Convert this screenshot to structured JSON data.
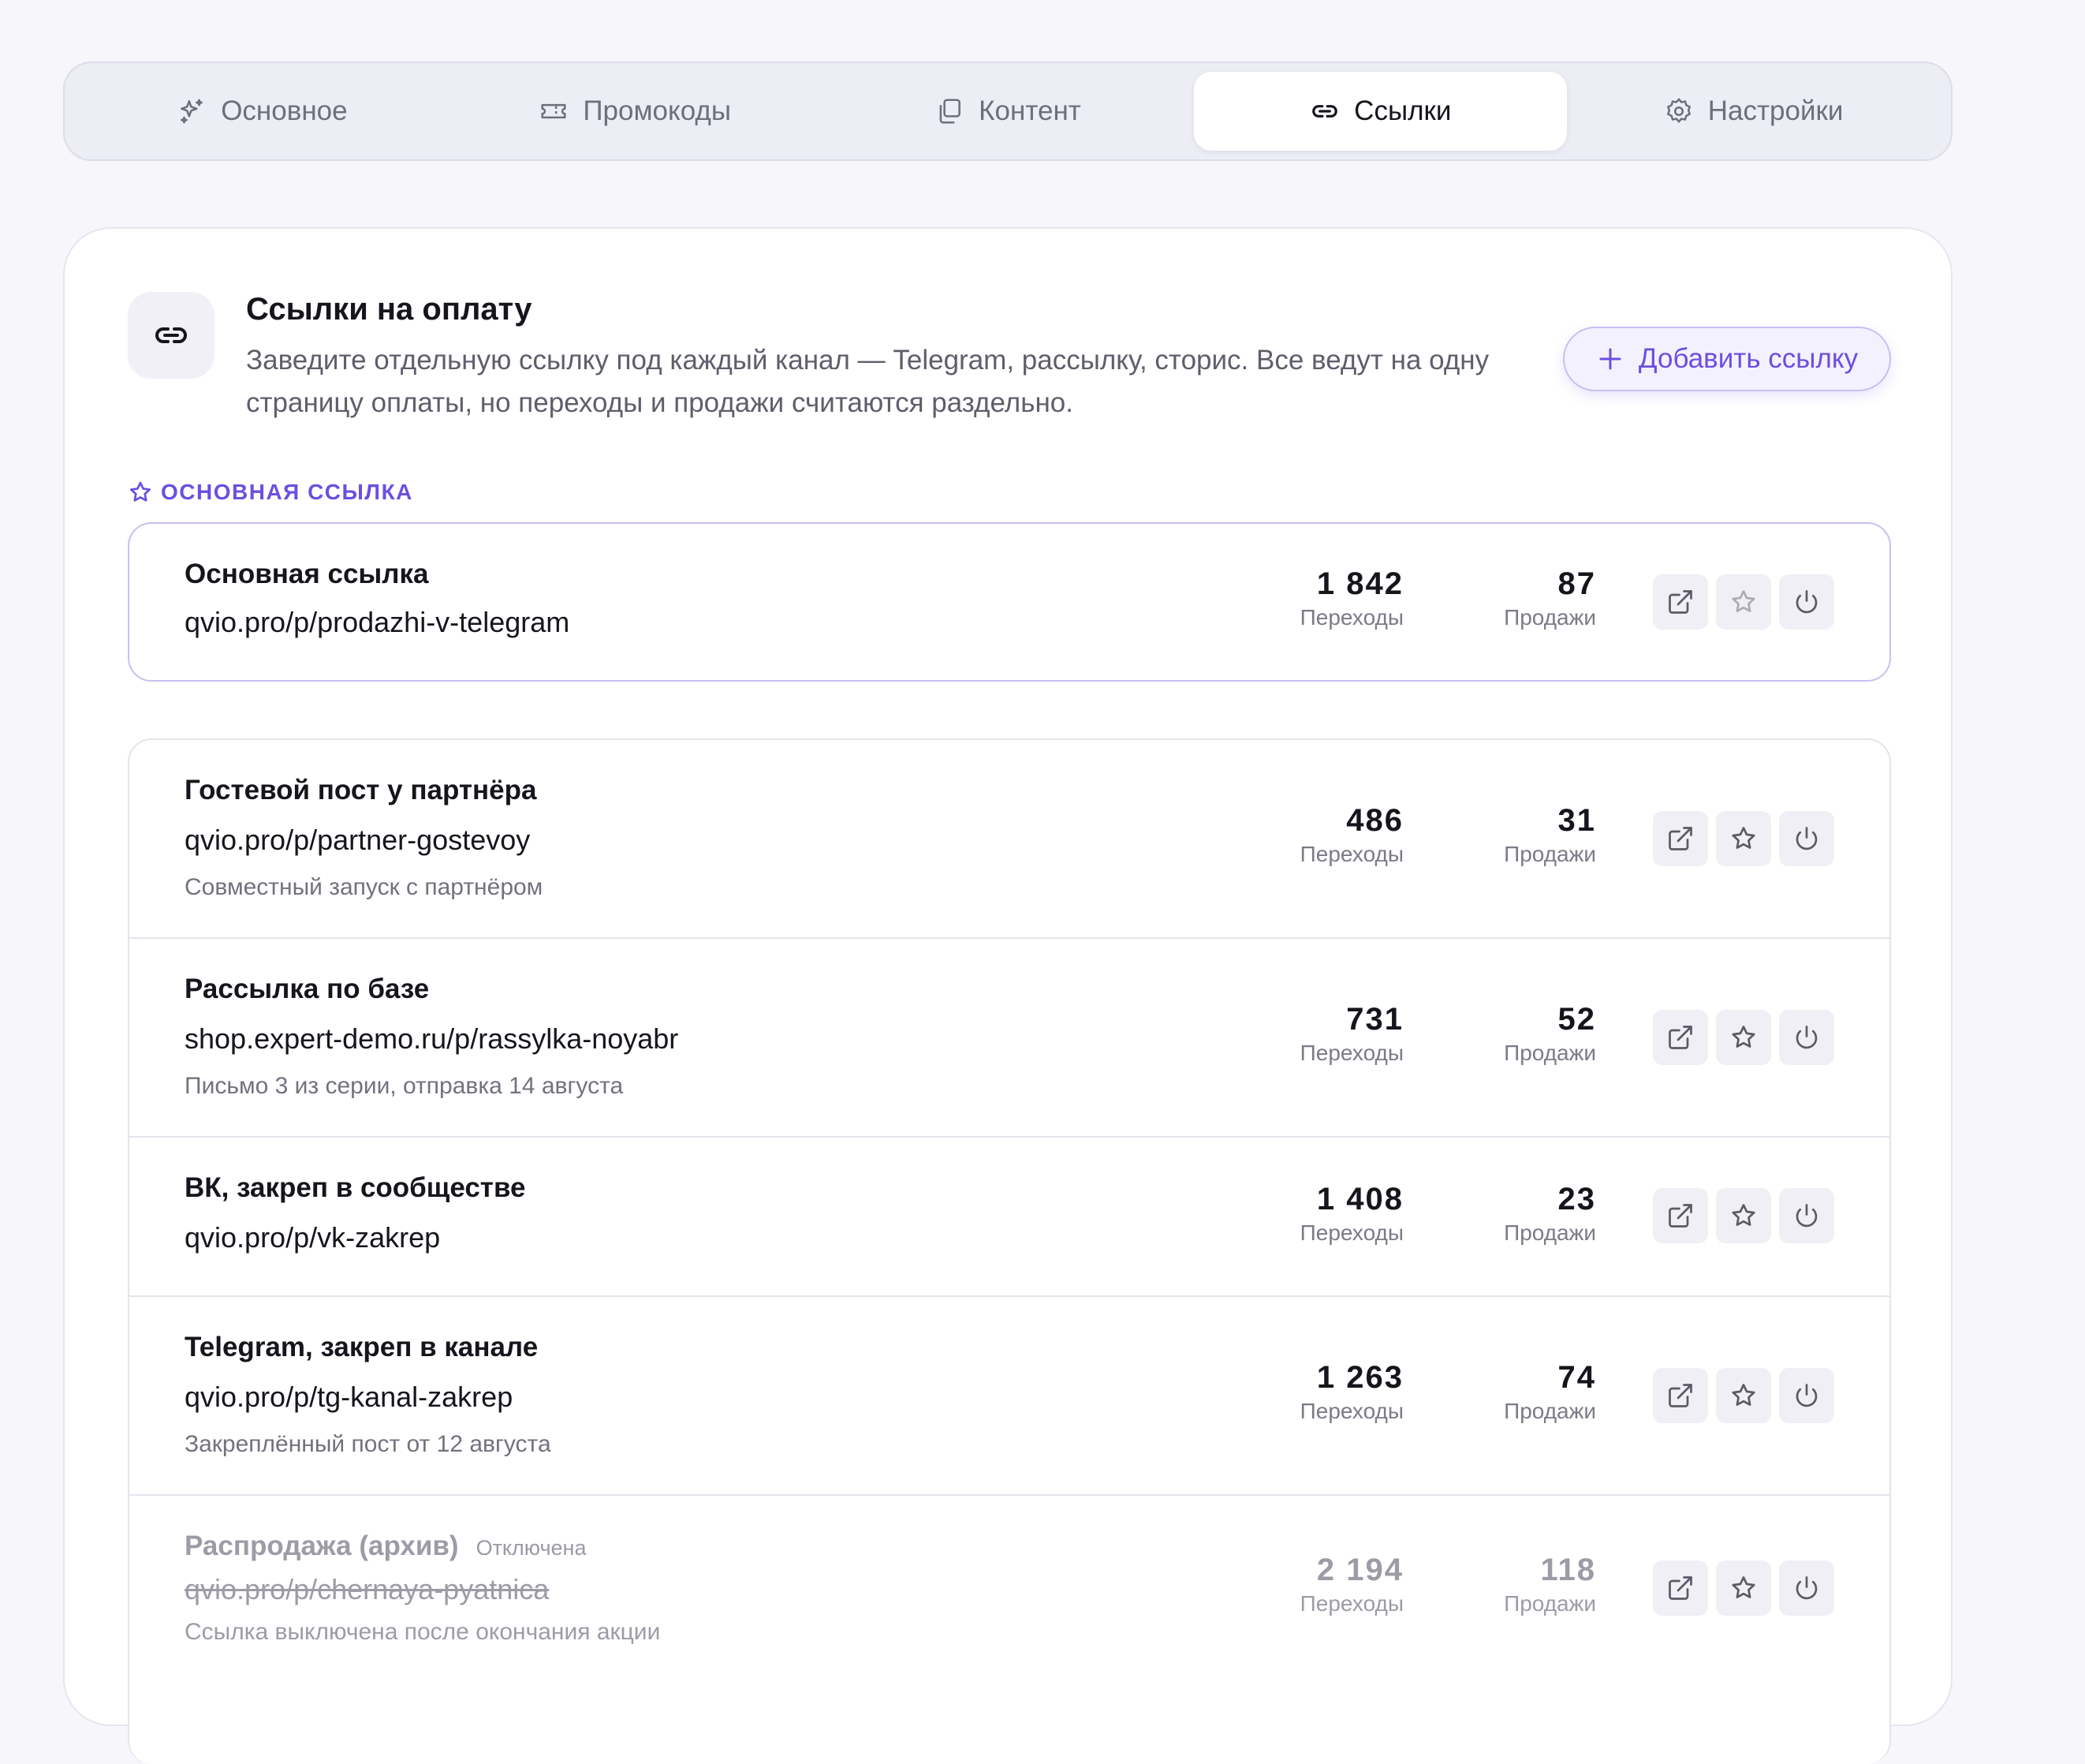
{
  "tabs": [
    {
      "label": "Основное",
      "icon": "sparkles-icon"
    },
    {
      "label": "Промокоды",
      "icon": "ticket-icon"
    },
    {
      "label": "Контент",
      "icon": "copy-icon"
    },
    {
      "label": "Ссылки",
      "icon": "link-icon",
      "active": true
    },
    {
      "label": "Настройки",
      "icon": "gear-icon"
    }
  ],
  "header": {
    "icon": "link-icon",
    "title": "Ссылки на оплату",
    "description": "Заведите отдельную ссылку под каждый канал — Telegram, рассылку, сторис. Все ведут на одну страницу оплаты, но переходы и продажи считаются раздельно.",
    "add_button": "Добавить ссылку"
  },
  "primary_section": {
    "label": "ОСНОВНАЯ ССЫЛКА",
    "link": {
      "name": "Основная ссылка",
      "url": "qvio.pro/p/prodazhi-v-telegram",
      "visits": "1 842",
      "visits_label": "Переходы",
      "sales": "87",
      "sales_label": "Продажи"
    }
  },
  "links": [
    {
      "name": "Гостевой пост у партнёра",
      "url": "qvio.pro/p/partner-gostevoy",
      "note": "Совместный запуск с партнёром",
      "visits": "486",
      "visits_label": "Переходы",
      "sales": "31",
      "sales_label": "Продажи"
    },
    {
      "name": "Рассылка по базе",
      "url": "shop.expert-demo.ru/p/rassylka-noyabr",
      "note": "Письмо 3 из серии, отправка 14 августа",
      "visits": "731",
      "visits_label": "Переходы",
      "sales": "52",
      "sales_label": "Продажи"
    },
    {
      "name": "ВК, закреп в сообществе",
      "url": "qvio.pro/p/vk-zakrep",
      "visits": "1 408",
      "visits_label": "Переходы",
      "sales": "23",
      "sales_label": "Продажи"
    },
    {
      "name": "Telegram, закреп в канале",
      "url": "qvio.pro/p/tg-kanal-zakrep",
      "note": "Закреплённый пост от 12 августа",
      "visits": "1 263",
      "visits_label": "Переходы",
      "sales": "74",
      "sales_label": "Продажи"
    },
    {
      "name": "Распродажа (архив)",
      "badge": "Отключена",
      "url": "qvio.pro/p/chernaya-pyatnica",
      "note": "Ссылка выключена после окончания акции",
      "visits": "2 194",
      "visits_label": "Переходы",
      "sales": "118",
      "sales_label": "Продажи",
      "disabled": true
    }
  ],
  "colors": {
    "accent": "#6b4fe0",
    "background": "#f6f6fb",
    "card": "#ffffff",
    "muted_text": "#72727e"
  }
}
